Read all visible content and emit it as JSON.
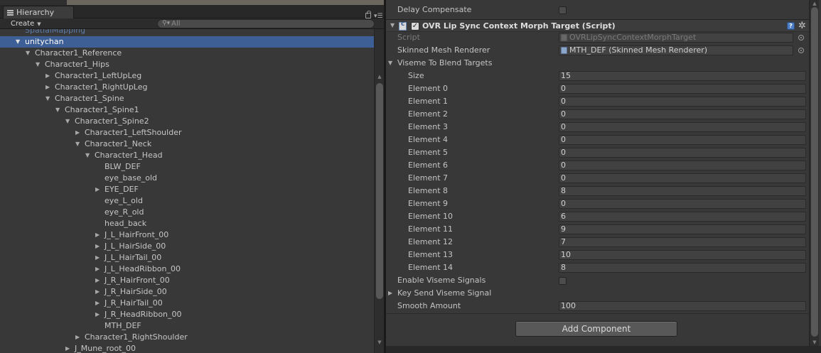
{
  "hierarchy": {
    "tab_label": "Hierarchy",
    "create_label": "Create",
    "search_placeholder": "All",
    "rows": [
      {
        "label": "SpatialMapping",
        "depth": 1,
        "arrow": "",
        "state": "partial"
      },
      {
        "label": "unitychan",
        "depth": 1,
        "arrow": "▼",
        "state": "selected"
      },
      {
        "label": "Character1_Reference",
        "depth": 2,
        "arrow": "▼",
        "state": ""
      },
      {
        "label": "Character1_Hips",
        "depth": 3,
        "arrow": "▼",
        "state": ""
      },
      {
        "label": "Character1_LeftUpLeg",
        "depth": 4,
        "arrow": "▶",
        "state": ""
      },
      {
        "label": "Character1_RightUpLeg",
        "depth": 4,
        "arrow": "▶",
        "state": ""
      },
      {
        "label": "Character1_Spine",
        "depth": 4,
        "arrow": "▼",
        "state": ""
      },
      {
        "label": "Character1_Spine1",
        "depth": 5,
        "arrow": "▼",
        "state": ""
      },
      {
        "label": "Character1_Spine2",
        "depth": 6,
        "arrow": "▼",
        "state": ""
      },
      {
        "label": "Character1_LeftShoulder",
        "depth": 7,
        "arrow": "▶",
        "state": ""
      },
      {
        "label": "Character1_Neck",
        "depth": 7,
        "arrow": "▼",
        "state": ""
      },
      {
        "label": "Character1_Head",
        "depth": 8,
        "arrow": "▼",
        "state": ""
      },
      {
        "label": "BLW_DEF",
        "depth": 9,
        "arrow": "",
        "state": ""
      },
      {
        "label": "eye_base_old",
        "depth": 9,
        "arrow": "",
        "state": ""
      },
      {
        "label": "EYE_DEF",
        "depth": 9,
        "arrow": "▶",
        "state": ""
      },
      {
        "label": "eye_L_old",
        "depth": 9,
        "arrow": "",
        "state": ""
      },
      {
        "label": "eye_R_old",
        "depth": 9,
        "arrow": "",
        "state": ""
      },
      {
        "label": "head_back",
        "depth": 9,
        "arrow": "",
        "state": ""
      },
      {
        "label": "J_L_HairFront_00",
        "depth": 9,
        "arrow": "▶",
        "state": ""
      },
      {
        "label": "J_L_HairSide_00",
        "depth": 9,
        "arrow": "▶",
        "state": ""
      },
      {
        "label": "J_L_HairTail_00",
        "depth": 9,
        "arrow": "▶",
        "state": ""
      },
      {
        "label": "J_L_HeadRibbon_00",
        "depth": 9,
        "arrow": "▶",
        "state": ""
      },
      {
        "label": "J_R_HairFront_00",
        "depth": 9,
        "arrow": "▶",
        "state": ""
      },
      {
        "label": "J_R_HairSide_00",
        "depth": 9,
        "arrow": "▶",
        "state": ""
      },
      {
        "label": "J_R_HairTail_00",
        "depth": 9,
        "arrow": "▶",
        "state": ""
      },
      {
        "label": "J_R_HeadRibbon_00",
        "depth": 9,
        "arrow": "▶",
        "state": ""
      },
      {
        "label": "MTH_DEF",
        "depth": 9,
        "arrow": "",
        "state": ""
      },
      {
        "label": "Character1_RightShoulder",
        "depth": 7,
        "arrow": "▶",
        "state": ""
      },
      {
        "label": "J_Mune_root_00",
        "depth": 6,
        "arrow": "▶",
        "state": ""
      }
    ]
  },
  "inspector": {
    "delay_compensate_label": "Delay Compensate",
    "component": {
      "title": "OVR Lip Sync Context Morph Target (Script)",
      "enabled_mark": "✓",
      "help_glyph": "?",
      "gear_glyph": "✲"
    },
    "script_label": "Script",
    "script_value": "OVRLipSyncContextMorphTarget",
    "skinned_mesh_label": "Skinned Mesh Renderer",
    "skinned_mesh_value": "MTH_DEF (Skinned Mesh Renderer)",
    "viseme_label": "Viseme To Blend Targets",
    "size_label": "Size",
    "size_value": "15",
    "elements": [
      {
        "label": "Element 0",
        "value": "0"
      },
      {
        "label": "Element 1",
        "value": "0"
      },
      {
        "label": "Element 2",
        "value": "0"
      },
      {
        "label": "Element 3",
        "value": "0"
      },
      {
        "label": "Element 4",
        "value": "0"
      },
      {
        "label": "Element 5",
        "value": "0"
      },
      {
        "label": "Element 6",
        "value": "0"
      },
      {
        "label": "Element 7",
        "value": "0"
      },
      {
        "label": "Element 8",
        "value": "8"
      },
      {
        "label": "Element 9",
        "value": "0"
      },
      {
        "label": "Element 10",
        "value": "6"
      },
      {
        "label": "Element 11",
        "value": "9"
      },
      {
        "label": "Element 12",
        "value": "7"
      },
      {
        "label": "Element 13",
        "value": "10"
      },
      {
        "label": "Element 14",
        "value": "8"
      }
    ],
    "enable_viseme_label": "Enable Viseme Signals",
    "key_send_label": "Key Send Viseme Signal",
    "smooth_amount_label": "Smooth Amount",
    "smooth_amount_value": "100",
    "add_component_label": "Add Component"
  },
  "colors": {
    "selection": "#3e5f96",
    "panel_bg": "#383838",
    "accent_blue": "#4d7dc4"
  }
}
